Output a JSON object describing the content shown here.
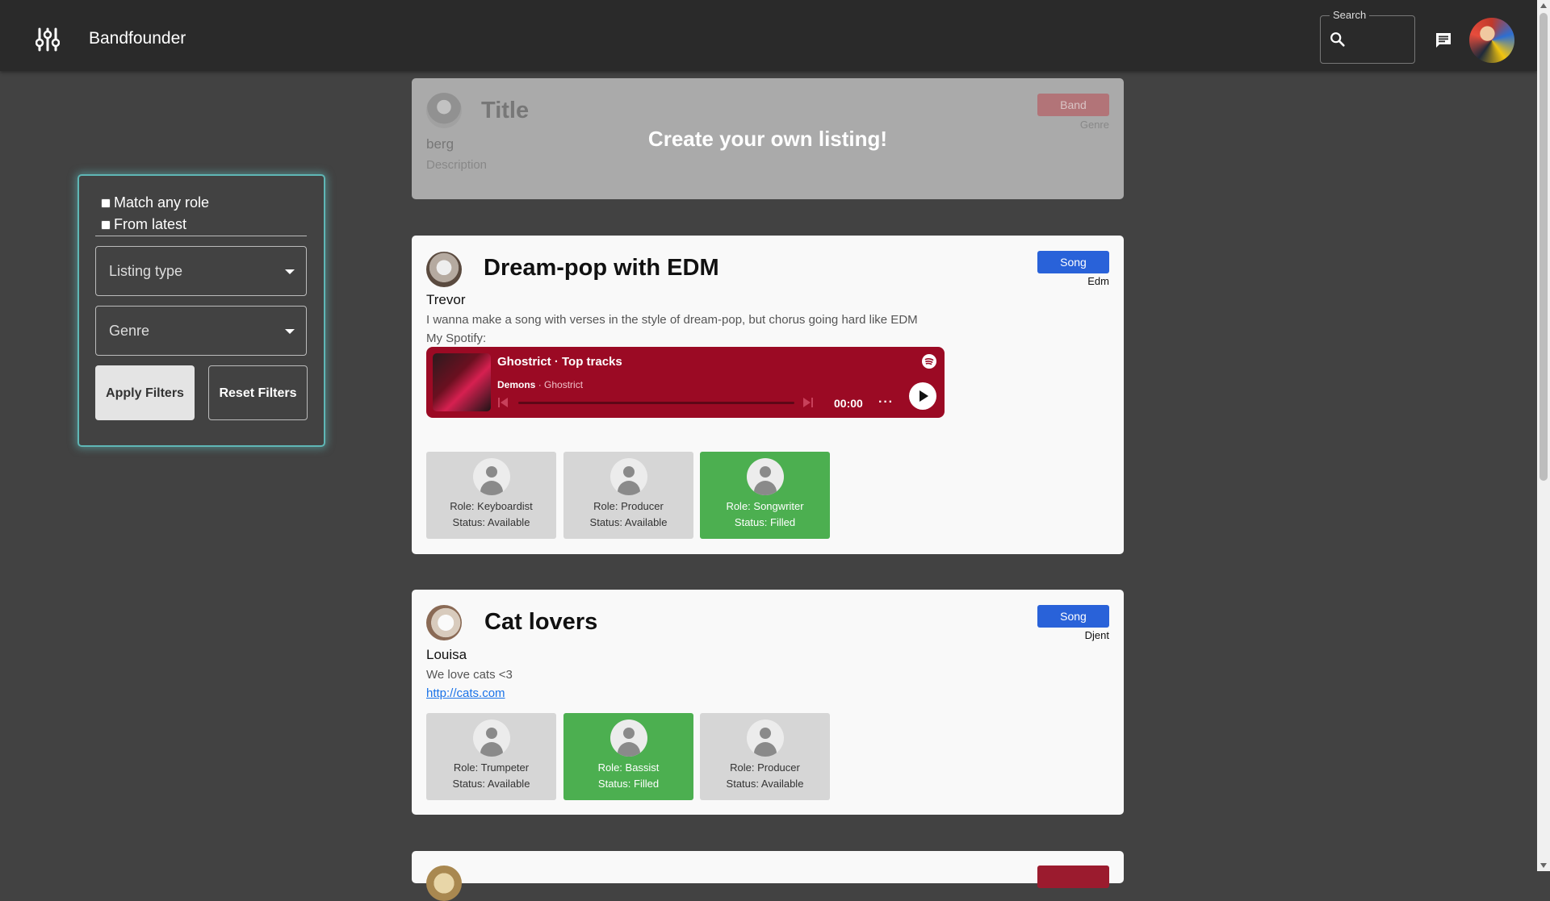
{
  "app": {
    "title": "Bandfounder"
  },
  "header": {
    "search": {
      "label": "Search",
      "value": "",
      "placeholder": ""
    },
    "icons": {
      "menu": "tune-sliders-icon",
      "chat": "chat-icon",
      "search": "search-icon"
    }
  },
  "filters": {
    "match_any_role": {
      "label": "Match any role",
      "checked": false
    },
    "from_latest": {
      "label": "From latest",
      "checked": false
    },
    "listing_type": {
      "label": "Listing type"
    },
    "genre": {
      "label": "Genre"
    },
    "apply_label": "Apply Filters",
    "reset_label": "Reset Filters"
  },
  "create_card": {
    "title": "Title",
    "badge": "Band",
    "genre": "Genre",
    "owner": "berg",
    "description": "Description",
    "overlay": "Create your own listing!"
  },
  "listings": [
    {
      "title": "Dream-pop with EDM",
      "badge": "Song",
      "genre": "Edm",
      "owner": "Trevor",
      "description": "I wanna make a song with verses in the style of dream-pop, but chorus going hard like EDM",
      "extra": "My Spotify:",
      "spotify": {
        "title": "Ghostrict · Top tracks",
        "track": "Demons",
        "artist": "Ghostrict",
        "time": "00:00",
        "more": "···"
      },
      "roles": [
        {
          "role": "Role: Keyboardist",
          "status": "Status: Available",
          "filled": false
        },
        {
          "role": "Role: Producer",
          "status": "Status: Available",
          "filled": false
        },
        {
          "role": "Role: Songwriter",
          "status": "Status: Filled",
          "filled": true
        }
      ]
    },
    {
      "title": "Cat lovers",
      "badge": "Song",
      "genre": "Djent",
      "owner": "Louisa",
      "description": "We love cats <3",
      "link": "http://cats.com",
      "roles": [
        {
          "role": "Role: Trumpeter",
          "status": "Status: Available",
          "filled": false
        },
        {
          "role": "Role: Bassist",
          "status": "Status: Filled",
          "filled": true
        },
        {
          "role": "Role: Producer",
          "status": "Status: Available",
          "filled": false
        }
      ]
    }
  ],
  "colors": {
    "background": "#424242",
    "topbar": "#2a2a2a",
    "song_badge": "#2962d9",
    "band_badge": "#b27478",
    "filled_role": "#4caf50",
    "available_role": "#d6d6d6",
    "spotify_embed": "#9b0a24",
    "filter_glow": "#5fb7b6"
  }
}
